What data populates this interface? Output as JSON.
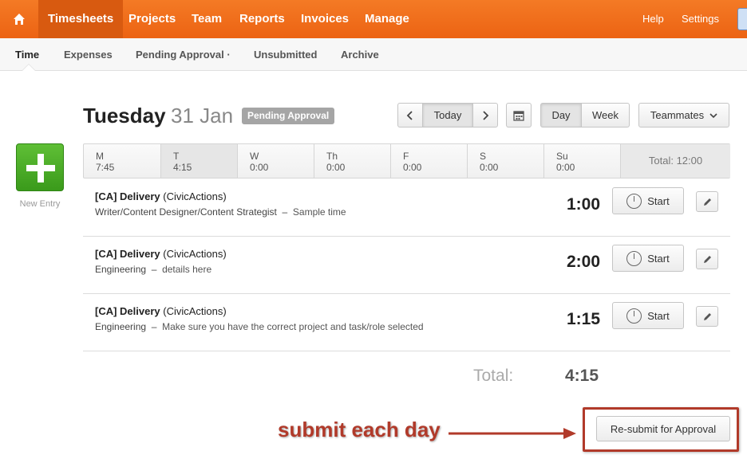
{
  "topnav": {
    "items": [
      {
        "label": "Timesheets",
        "active": true
      },
      {
        "label": "Projects"
      },
      {
        "label": "Team"
      },
      {
        "label": "Reports"
      },
      {
        "label": "Invoices"
      },
      {
        "label": "Manage"
      }
    ],
    "help": "Help",
    "settings": "Settings"
  },
  "subnav": {
    "items": [
      {
        "label": "Time",
        "active": true
      },
      {
        "label": "Expenses"
      },
      {
        "label": "Pending Approval ·"
      },
      {
        "label": "Unsubmitted"
      },
      {
        "label": "Archive"
      }
    ]
  },
  "heading": {
    "day": "Tuesday",
    "date": "31 Jan",
    "badge": "Pending Approval"
  },
  "controls": {
    "today": "Today",
    "day": "Day",
    "week": "Week",
    "teammates": "Teammates"
  },
  "new_entry": {
    "label": "New Entry"
  },
  "week": {
    "days": [
      {
        "name": "M",
        "hours": "7:45"
      },
      {
        "name": "T",
        "hours": "4:15",
        "active": true
      },
      {
        "name": "W",
        "hours": "0:00"
      },
      {
        "name": "Th",
        "hours": "0:00"
      },
      {
        "name": "F",
        "hours": "0:00"
      },
      {
        "name": "S",
        "hours": "0:00"
      },
      {
        "name": "Su",
        "hours": "0:00"
      }
    ],
    "total": "Total: 12:00"
  },
  "entries": [
    {
      "project": "[CA] Delivery",
      "client": "(CivicActions)",
      "task": "Writer/Content Designer/Content Strategist",
      "note": "Sample time",
      "duration": "1:00",
      "start": "Start"
    },
    {
      "project": "[CA] Delivery",
      "client": "(CivicActions)",
      "task": "Engineering",
      "note": "details here",
      "duration": "2:00",
      "start": "Start"
    },
    {
      "project": "[CA] Delivery",
      "client": "(CivicActions)",
      "task": "Engineering",
      "note": "Make sure you have the correct project and task/role selected",
      "duration": "1:15",
      "start": "Start"
    }
  ],
  "day_total": {
    "label": "Total:",
    "value": "4:15"
  },
  "resubmit": "Re-submit for Approval",
  "annotation": "submit each day",
  "colors": {
    "brand": "#f26f21",
    "new_entry": "#4caf2b",
    "annotation": "#b13a2a"
  }
}
